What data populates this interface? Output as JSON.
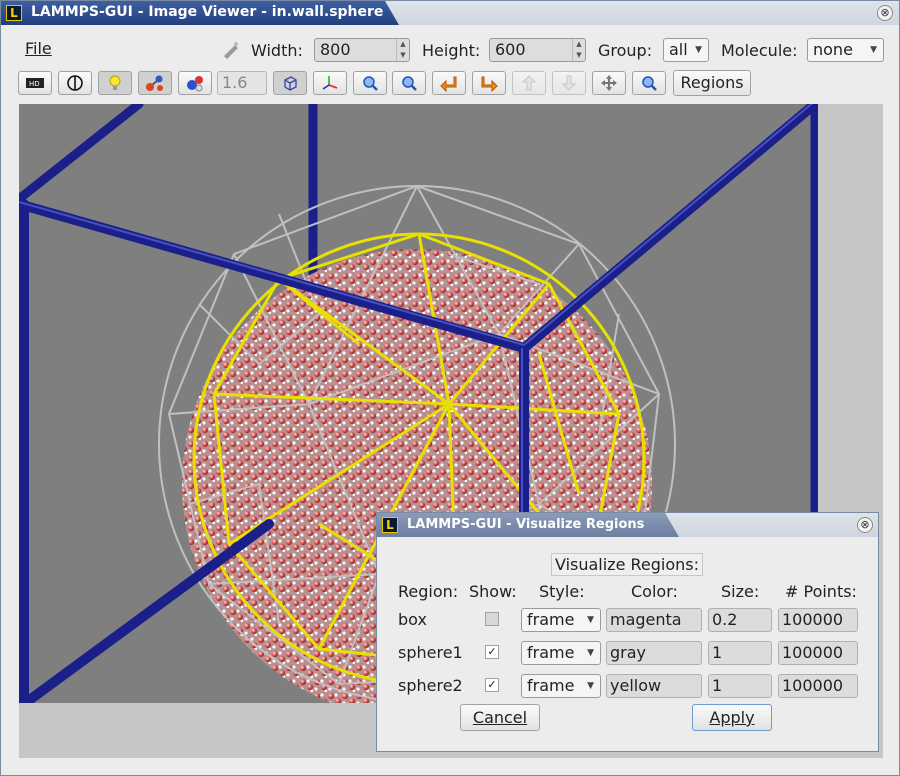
{
  "window": {
    "title": "LAMMPS-GUI - Image Viewer - in.wall.sphere",
    "app_icon": "L",
    "close_glyph": "⊗"
  },
  "menu": {
    "file": "File"
  },
  "settings": {
    "width_label": "Width:",
    "width_value": "800",
    "height_label": "Height:",
    "height_value": "600",
    "group_label": "Group:",
    "group_value": "all",
    "molecule_label": "Molecule:",
    "molecule_value": "none"
  },
  "toolbar": {
    "icons": [
      "hd-icon",
      "vdw-toggle-icon",
      "lightbulb-icon",
      "atoms-bonds-icon",
      "molecule-icon",
      "zoom-value",
      "axes-box-icon",
      "axes-icon",
      "zoom-in-icon",
      "zoom-out-icon",
      "rotate-left-icon",
      "rotate-right-icon",
      "rotate-up-icon",
      "rotate-down-icon",
      "recenter-icon",
      "reset-view-icon"
    ],
    "zoom_value": "1.6",
    "regions_label": "Regions"
  },
  "dialog": {
    "title": "LAMMPS-GUI - Visualize Regions",
    "heading": "Visualize Regions:",
    "columns": [
      "Region:",
      "Show:",
      "Style:",
      "Color:",
      "Size:",
      "# Points:"
    ],
    "rows": [
      {
        "name": "box",
        "show": false,
        "show_enabled": false,
        "style": "frame",
        "color": "magenta",
        "size": "0.2",
        "points": "100000"
      },
      {
        "name": "sphere1",
        "show": true,
        "show_enabled": true,
        "style": "frame",
        "color": "gray",
        "size": "1",
        "points": "100000"
      },
      {
        "name": "sphere2",
        "show": true,
        "show_enabled": true,
        "style": "frame",
        "color": "yellow",
        "size": "1",
        "points": "100000"
      }
    ],
    "cancel_label": "Cancel",
    "apply_label": "Apply"
  },
  "colors": {
    "title_bar": "#23407d",
    "box_frame": "#1a1f8a",
    "sphere1_frame": "#b4b4b4",
    "sphere2_frame": "#e8e000",
    "scene_background": "#7f7f7f",
    "atom_oxygen": "#d24a4a",
    "atom_hydrogen": "#f4f4f4"
  }
}
